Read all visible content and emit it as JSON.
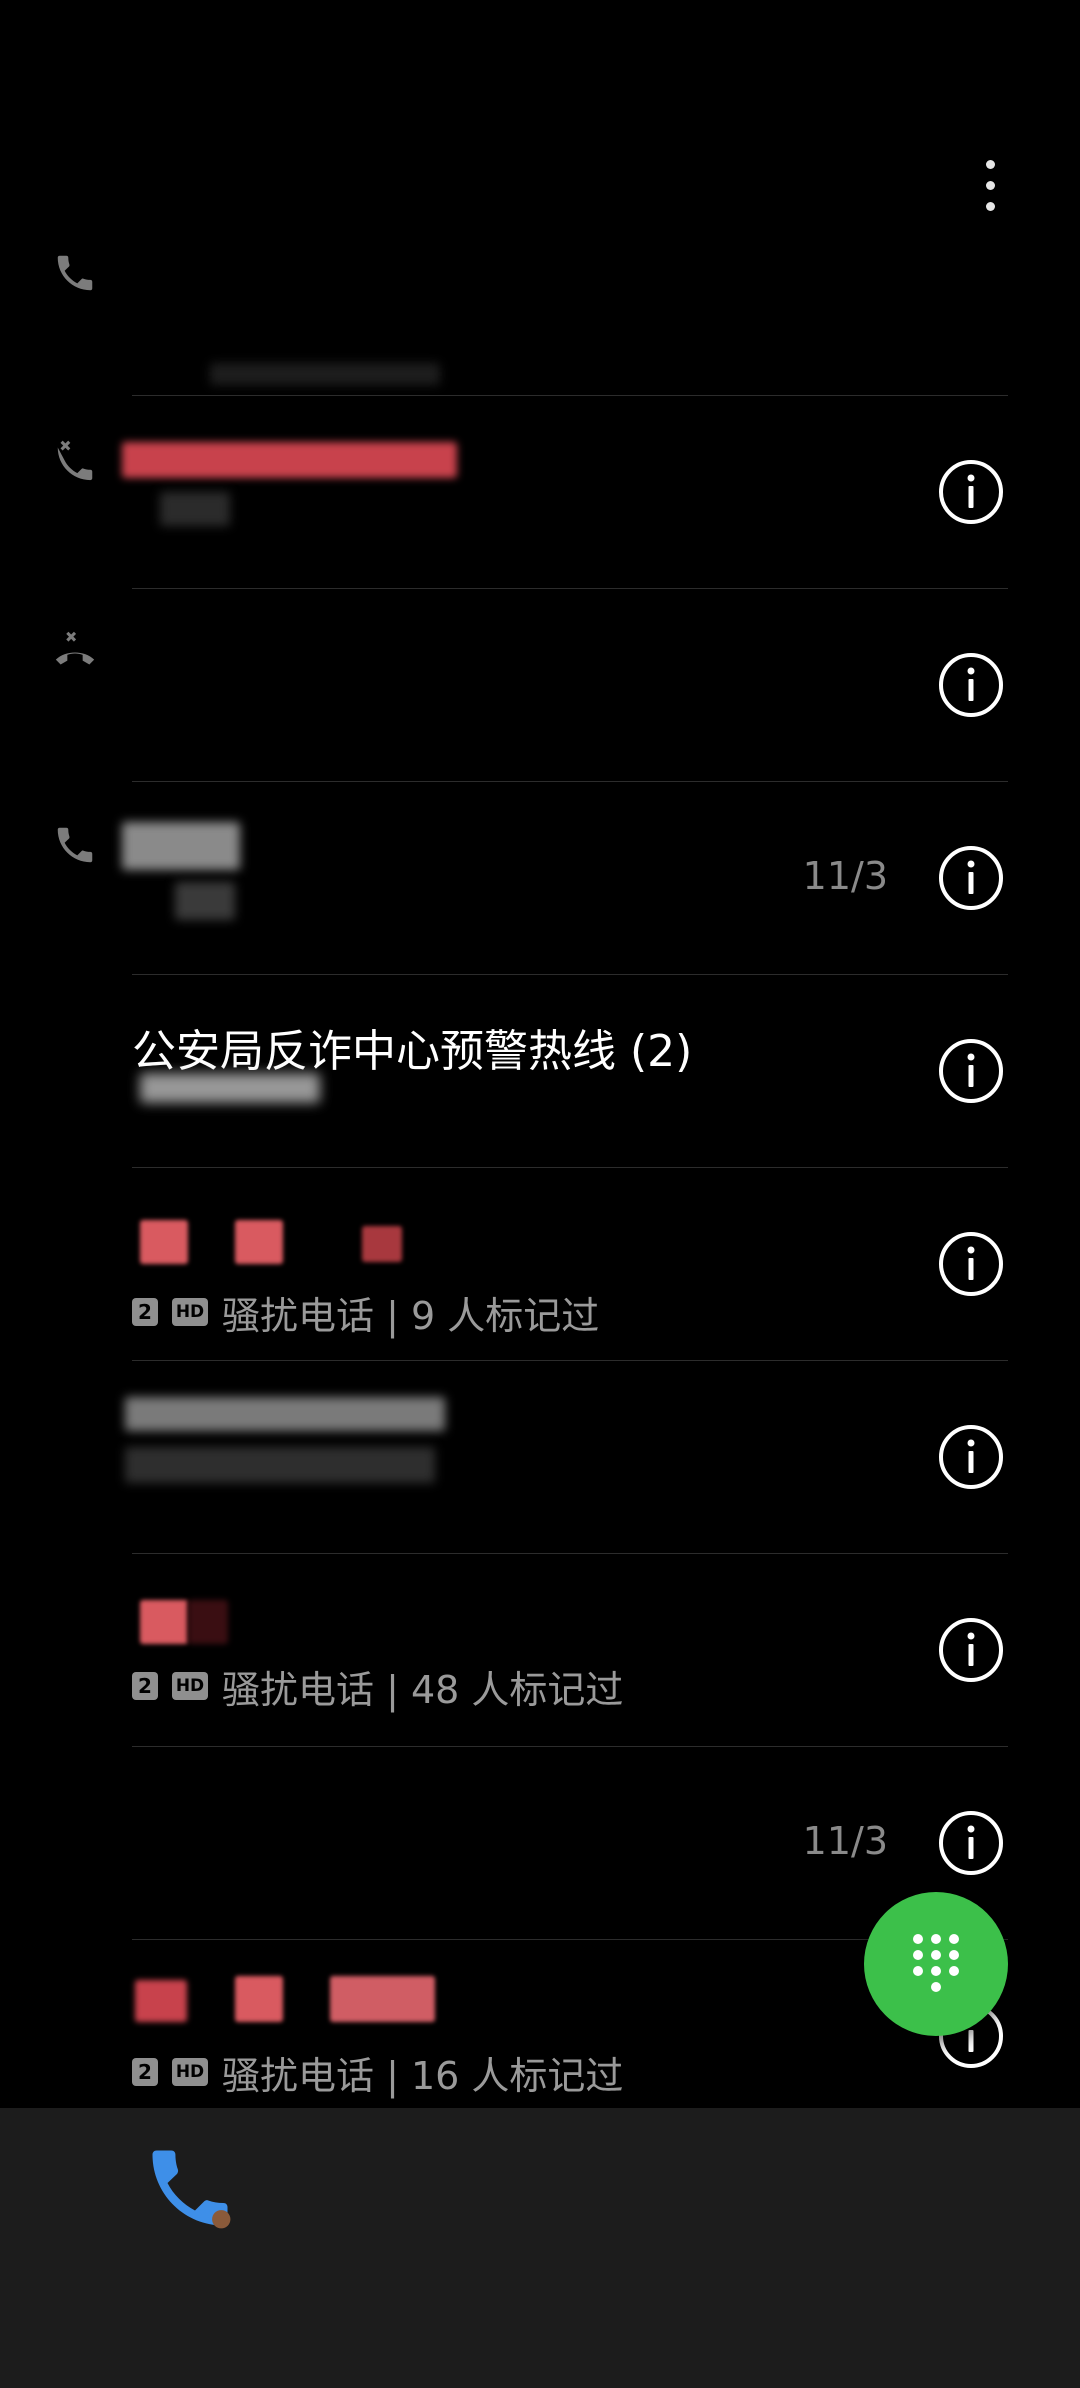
{
  "colors": {
    "background": "#000000",
    "bottom_nav": "#1c1c1c",
    "fab": "#3cc04a",
    "nav_active": "#3e8fe8",
    "redacted_red": "#d95a60"
  },
  "icons": {
    "more": "more-vert-icon",
    "info": "info-circle-icon",
    "dialpad": "dialpad-icon",
    "phone": "phone-icon"
  },
  "calls": [
    {
      "type": "phone",
      "name": "",
      "sub": "",
      "date": "",
      "info": false
    },
    {
      "type": "missed",
      "name": "",
      "sub": "",
      "date": "",
      "info": true
    },
    {
      "type": "missed",
      "name": "",
      "sub": "",
      "date": "",
      "info": true
    },
    {
      "type": "phone",
      "name": "",
      "sub": "",
      "date": "11/3",
      "info": true
    },
    {
      "type": "",
      "name": "公安局反诈中心预警热线 (2)",
      "sub": "",
      "date": "",
      "info": true
    },
    {
      "type": "",
      "name": "",
      "sim": "2",
      "hd": "HD",
      "sub": "骚扰电话 | 9 人标记过",
      "date": "",
      "info": true
    },
    {
      "type": "",
      "name": "",
      "sub": "",
      "date": "",
      "info": true
    },
    {
      "type": "",
      "name": "",
      "sim": "2",
      "hd": "HD",
      "sub": "骚扰电话 | 48 人标记过",
      "date": "",
      "info": true
    },
    {
      "type": "",
      "name": "",
      "sub": "",
      "date": "11/3",
      "info": true
    },
    {
      "type": "",
      "name": "",
      "sim": "2",
      "hd": "HD",
      "sub": "骚扰电话 | 16 人标记过",
      "date": "",
      "info": true
    }
  ]
}
